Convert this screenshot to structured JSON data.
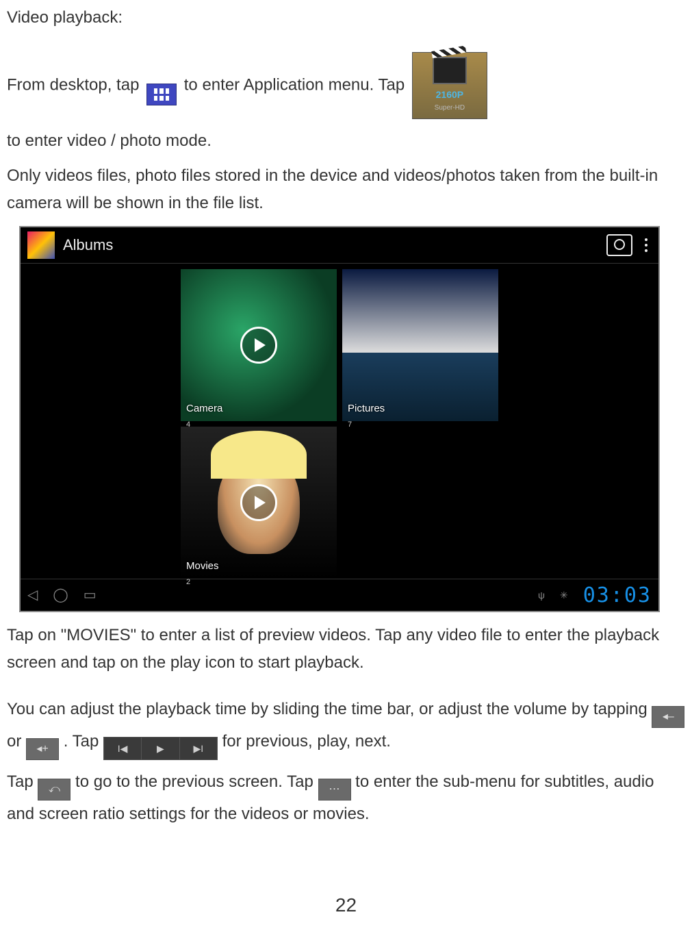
{
  "title": "Video playback:",
  "line1a": "From desktop, tap ",
  "line1b": "  to enter Application menu.    Tap",
  "line2": "to enter video / photo mode.",
  "para2": "Only videos files, photo files stored in the device and videos/photos taken from the built-in camera will be shown in the file list.",
  "albums_header": "Albums",
  "album_camera": "Camera",
  "album_camera_count": "4",
  "album_pictures": "Pictures",
  "album_pictures_count": "7",
  "album_movies": "Movies",
  "album_movies_count": "2",
  "clock_time": "03:03",
  "media_icon_line1": "2160P",
  "media_icon_line2": "Super-HD",
  "para3": "Tap on \"MOVIES\" to enter a list of preview videos.    Tap any video file to enter the playback screen and tap on the play icon to start playback.",
  "para4a": "You can adjust the playback time by sliding the time bar, or adjust the volume by tapping ",
  "para4_or": " or ",
  "para4_dot": ".      Tap ",
  "para4b": "  for previous, play, next.",
  "para5a": "Tap ",
  "para5b": " to go to the previous screen.    Tap ",
  "para5c": " to enter the sub-menu for subtitles, audio and screen ratio settings for the videos or movies.",
  "page_number": "22"
}
